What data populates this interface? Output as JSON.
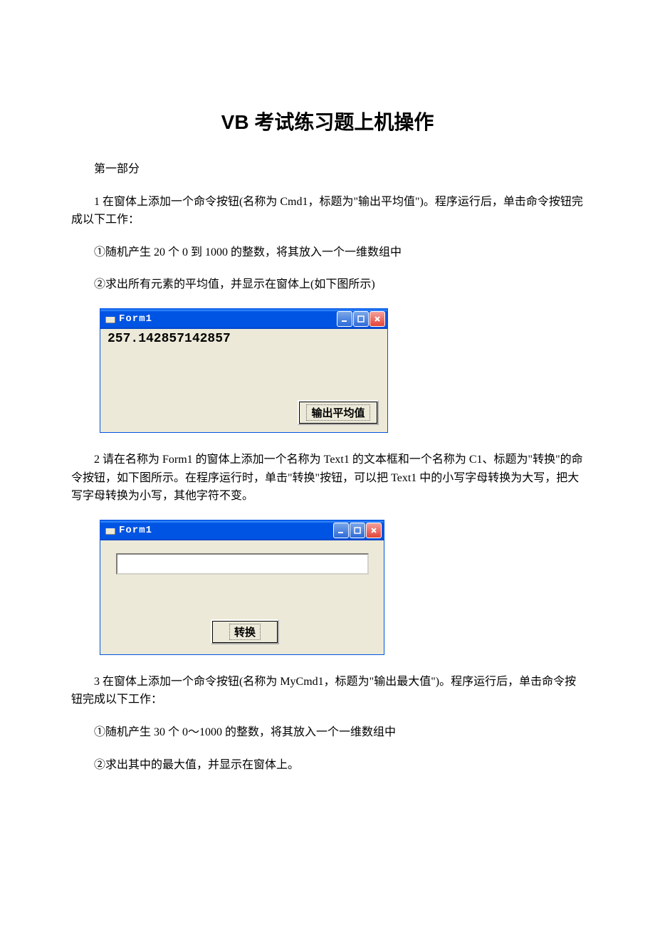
{
  "title": "VB 考试练习题上机操作",
  "section_heading": "第一部分",
  "q1": {
    "intro": "1 在窗体上添加一个命令按钮(名称为 Cmd1，标题为\"输出平均值\")。程序运行后，单击命令按钮完成以下工作：",
    "step1": "①随机产生 20 个 0 到 1000 的整数，将其放入一个一维数组中",
    "step2": "②求出所有元素的平均值，并显示在窗体上(如下图所示)"
  },
  "form1": {
    "title": "Form1",
    "output": "257.142857142857",
    "button": "输出平均值"
  },
  "q2": {
    "intro": "2 请在名称为 Form1 的窗体上添加一个名称为 Text1 的文本框和一个名称为 C1、标题为\"转换\"的命令按钮，如下图所示。在程序运行时，单击\"转换\"按钮，可以把 Text1 中的小写字母转换为大写，把大写字母转换为小写，其他字符不变。"
  },
  "form2": {
    "title": "Form1",
    "button": "转换"
  },
  "q3": {
    "intro": "3 在窗体上添加一个命令按钮(名称为 MyCmd1，标题为\"输出最大值\")。程序运行后，单击命令按钮完成以下工作：",
    "step1": "①随机产生 30 个 0～1000 的整数，将其放入一个一维数组中",
    "step2": "②求出其中的最大值，并显示在窗体上。"
  }
}
